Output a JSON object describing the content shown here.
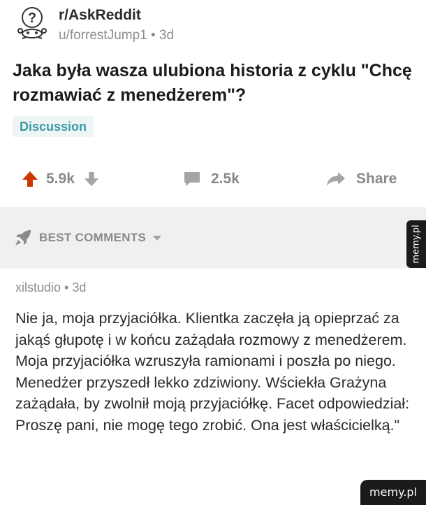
{
  "post": {
    "subreddit": "r/AskReddit",
    "meta": "u/forrestJump1 • 3d",
    "title": "Jaka była wasza ulubiona historia z cyklu \"Chcę rozmawiać z menedżerem\"?",
    "flair": "Discussion",
    "upvotes": "5.9k",
    "comments": "2.5k",
    "share_label": "Share"
  },
  "sort": {
    "label": "BEST COMMENTS"
  },
  "comment": {
    "meta": "xilstudio • 3d",
    "body": "Nie ja, moja przyjaciółka. Klientka zaczęła ją opieprzać za jakąś głupotę i w końcu zażądała rozmowy z menedżerem. Moja przyjaciółka wzruszyła ramionami i poszła po niego. Menedżer przyszedł lekko zdziwiony. Wściekła Grażyna zażądała, by zwolnił moją przyjaciółkę. Facet odpowiedział: Proszę pani, nie mogę tego zrobić. Ona jest właścicielką.\""
  },
  "watermark": {
    "text": "memy.pl"
  },
  "colors": {
    "upvote": "#cc3700",
    "flair_text": "#3a9aa6",
    "flair_bg": "#edf5f6",
    "muted": "#878a8c"
  },
  "icons": [
    "snoo-question-icon",
    "upvote-arrow-icon",
    "downvote-arrow-icon",
    "comment-bubble-icon",
    "share-arrow-icon",
    "rocket-icon",
    "caret-down-icon"
  ]
}
